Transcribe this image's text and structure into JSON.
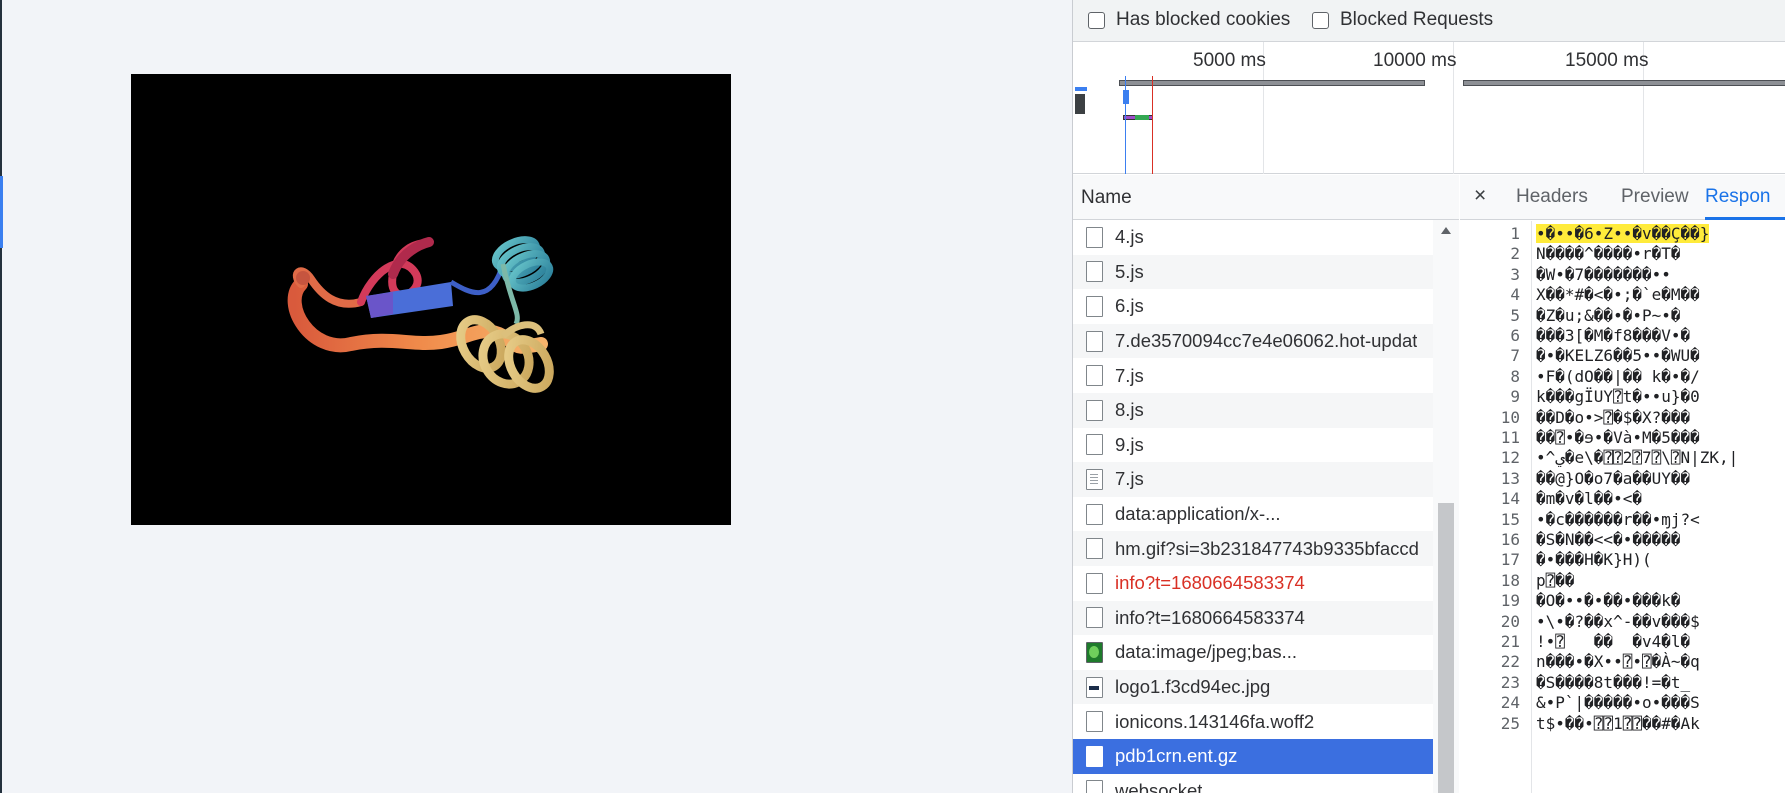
{
  "viewer": {
    "subject": "protein-ribbon-render"
  },
  "devtools": {
    "filters": [
      {
        "label": "Has blocked cookies",
        "checked": false
      },
      {
        "label": "Blocked Requests",
        "checked": false
      }
    ],
    "overview": {
      "ticks": [
        "5000 ms",
        "10000 ms",
        "15000 ms"
      ]
    },
    "name_column_header": "Name",
    "requests": [
      {
        "name": "4.js",
        "icon": "file-icon",
        "status": "normal"
      },
      {
        "name": "5.js",
        "icon": "file-icon",
        "status": "normal"
      },
      {
        "name": "6.js",
        "icon": "file-icon",
        "status": "normal"
      },
      {
        "name": "7.de3570094cc7e4e06062.hot-updat",
        "icon": "file-icon",
        "status": "normal"
      },
      {
        "name": "7.js",
        "icon": "file-icon",
        "status": "normal"
      },
      {
        "name": "8.js",
        "icon": "file-icon",
        "status": "normal"
      },
      {
        "name": "9.js",
        "icon": "file-icon",
        "status": "normal"
      },
      {
        "name": "7.js",
        "icon": "document-icon",
        "status": "normal"
      },
      {
        "name": "data:application/x-...",
        "icon": "file-icon",
        "status": "normal"
      },
      {
        "name": "hm.gif?si=3b231847743b9335bfaccd",
        "icon": "file-icon",
        "status": "normal"
      },
      {
        "name": "info?t=1680664583374",
        "icon": "file-icon",
        "status": "error"
      },
      {
        "name": "info?t=1680664583374",
        "icon": "file-icon",
        "status": "normal"
      },
      {
        "name": "data:image/jpeg;bas...",
        "icon": "image-icon",
        "status": "normal"
      },
      {
        "name": "logo1.f3cd94ec.jpg",
        "icon": "logo-image-icon",
        "status": "normal"
      },
      {
        "name": "ionicons.143146fa.woff2",
        "icon": "file-icon",
        "status": "normal"
      },
      {
        "name": "pdb1crn.ent.gz",
        "icon": "file-icon",
        "status": "selected"
      },
      {
        "name": "websocket",
        "icon": "file-icon",
        "status": "normal"
      }
    ],
    "detail": {
      "close": "×",
      "tabs": [
        "Headers",
        "Preview",
        "Respon"
      ],
      "active_tab": "Respon"
    },
    "response_lines": [
      {
        "n": "1",
        "text": "•�••�6•Z••�v��Ç��}"
      },
      {
        "n": "2",
        "text": "N����^����•r�T�"
      },
      {
        "n": "3",
        "text": "�W•�7�������••"
      },
      {
        "n": "4",
        "text": "X��*#�<�•;�`e�M��"
      },
      {
        "n": "5",
        "text": "�Z�u;&��•�•P~•�"
      },
      {
        "n": "6",
        "text": "���3[�M�f8���V•�"
      },
      {
        "n": "7",
        "text": "�•�KELZ6��5••�WU�"
      },
      {
        "n": "8",
        "text": "•F�(dO��|�� k�•�/"
      },
      {
        "n": "9",
        "text": "k���gÏUY⍰t�••u}�0"
      },
      {
        "n": "10",
        "text": "��D�o•>⍰�$�X?���"
      },
      {
        "n": "11",
        "text": "��⍰•�ɘ•�Và•M�5���"
      },
      {
        "n": "12",
        "text": "•^ي�e\\�⍰⍰2⍰7⍰\\⍰N|ZK,|"
      },
      {
        "n": "13",
        "text": "��@}O�o7�a��UY��"
      },
      {
        "n": "14",
        "text": "�m�v�l��•<�"
      },
      {
        "n": "15",
        "text": "•�c������r��•ɱj?<"
      },
      {
        "n": "16",
        "text": "�S�N��<<�•�����"
      },
      {
        "n": "17",
        "text": "�•���H�K}H)("
      },
      {
        "n": "18",
        "text": "p⍰��"
      },
      {
        "n": "19",
        "text": "�O�••�•��•���k�"
      },
      {
        "n": "20",
        "text": "•\\•�?��x^-��v���$"
      },
      {
        "n": "21",
        "text": "!•⍰   ��  �v4�l�"
      },
      {
        "n": "22",
        "text": "n���•�X••⍰•⍰�À~�q"
      },
      {
        "n": "23",
        "text": "�S����8t���!=�t_"
      },
      {
        "n": "24",
        "text": "&•P`|�����•o•���S"
      },
      {
        "n": "25",
        "text": "t$•��•⍰⍰1⍰⍰��#�Ak"
      }
    ]
  }
}
